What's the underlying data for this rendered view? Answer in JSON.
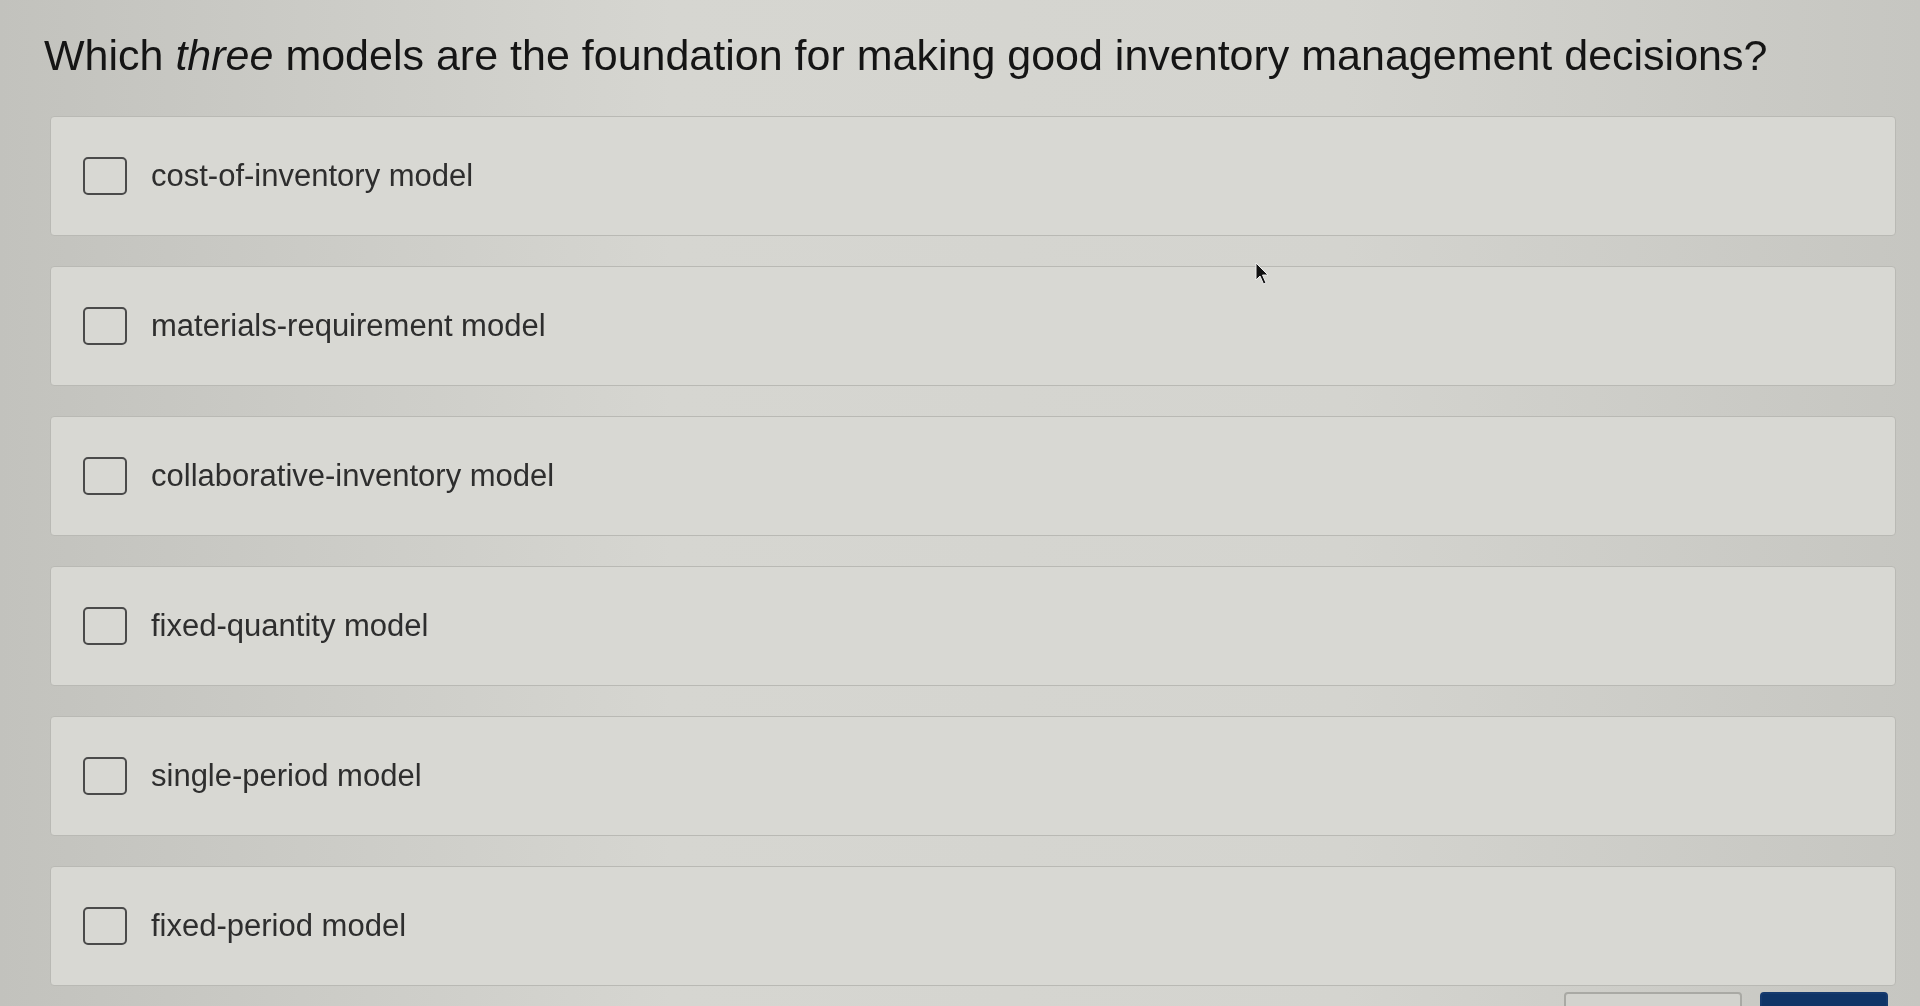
{
  "question": {
    "text": "Which *three* models are the foundation for making good inventory management decisions?"
  },
  "options": [
    {
      "label": "cost-of-inventory model",
      "checked": false
    },
    {
      "label": "materials-requirement model",
      "checked": false
    },
    {
      "label": "collaborative-inventory model",
      "checked": false
    },
    {
      "label": "fixed-quantity model",
      "checked": false
    },
    {
      "label": "single-period model",
      "checked": false
    },
    {
      "label": "fixed-period model",
      "checked": false
    }
  ],
  "footer_buttons": [
    {
      "kind": "secondary"
    },
    {
      "kind": "primary"
    }
  ]
}
